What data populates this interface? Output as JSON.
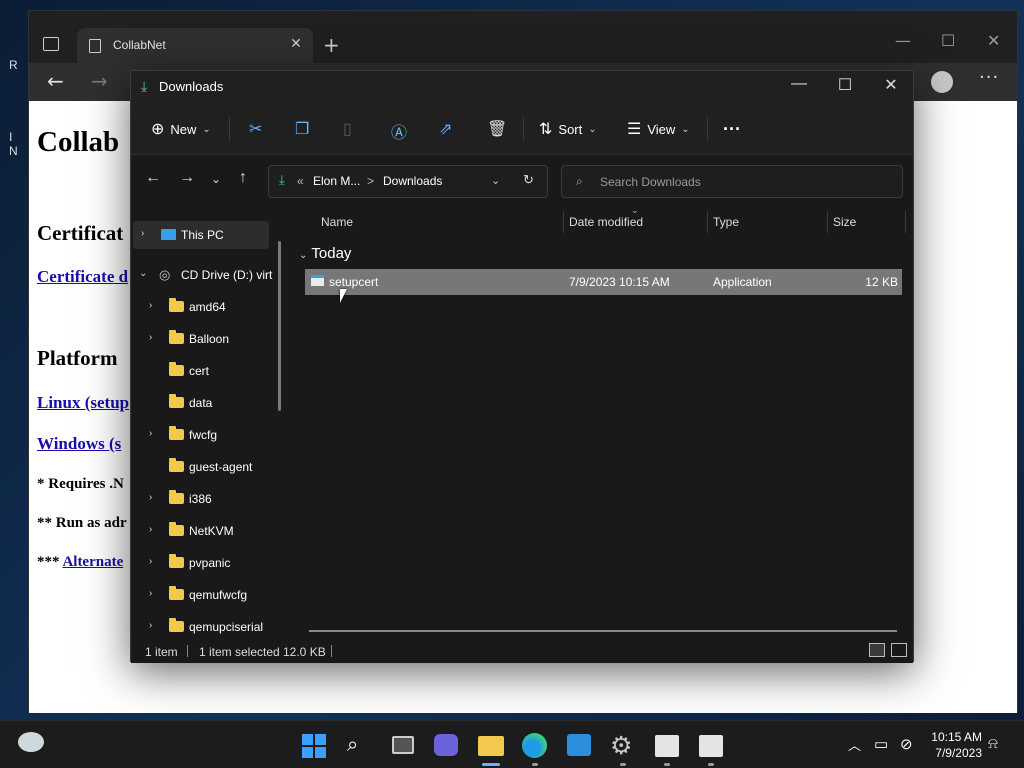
{
  "desktop": {
    "fragment_1": "R",
    "fragment_2": "I",
    "fragment_3": "N"
  },
  "browser": {
    "tab_title": "CollabNet",
    "tab_close": "✕",
    "new_tab": "+",
    "content": {
      "heading": "Collab",
      "section_1": "Certificat",
      "link_1": "Certificate d",
      "section_2": "Platform",
      "link_2": "Linux (setup",
      "link_3": "Windows (s",
      "note_1": "* Requires .N",
      "note_2": "** Run as adr",
      "note_3_prefix": "*** ",
      "note_3_link": "Alternate"
    }
  },
  "explorer": {
    "title": "Downloads",
    "commands": {
      "new": "New",
      "sort": "Sort",
      "view": "View",
      "more": "···"
    },
    "address": {
      "prefix": "«",
      "parent": "Elon M...",
      "separator": ">",
      "current": "Downloads"
    },
    "search_placeholder": "Search Downloads",
    "nav": {
      "this_pc": "This PC",
      "cd_drive": "CD Drive (D:) virt",
      "folders": [
        {
          "label": "amd64",
          "expandable": true
        },
        {
          "label": "Balloon",
          "expandable": true
        },
        {
          "label": "cert",
          "expandable": false
        },
        {
          "label": "data",
          "expandable": false
        },
        {
          "label": "fwcfg",
          "expandable": true
        },
        {
          "label": "guest-agent",
          "expandable": false
        },
        {
          "label": "i386",
          "expandable": true
        },
        {
          "label": "NetKVM",
          "expandable": true
        },
        {
          "label": "pvpanic",
          "expandable": true
        },
        {
          "label": "qemufwcfg",
          "expandable": true
        },
        {
          "label": "qemupciserial",
          "expandable": true
        }
      ]
    },
    "columns": {
      "name": "Name",
      "date": "Date modified",
      "type": "Type",
      "size": "Size"
    },
    "group": "Today",
    "files": [
      {
        "name": "setupcert",
        "date": "7/9/2023 10:15 AM",
        "type": "Application",
        "size": "12 KB"
      }
    ],
    "status": {
      "count": "1 item",
      "selected": "1 item selected",
      "size": "12.0 KB"
    }
  },
  "taskbar": {
    "time": "10:15 AM",
    "date": "7/9/2023"
  },
  "colors": {
    "accent": "#3aa0ff",
    "folder": "#f2c94c",
    "selection": "#777777"
  }
}
